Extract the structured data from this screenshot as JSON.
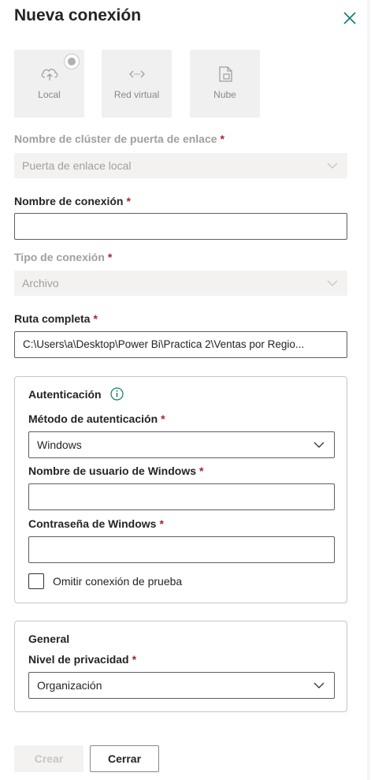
{
  "panel": {
    "title": "Nueva conexión"
  },
  "tiles": [
    {
      "label": "Local",
      "icon": "cloud-upload-icon",
      "selected": true
    },
    {
      "label": "Red virtual",
      "icon": "virtual-network-icon",
      "selected": false
    },
    {
      "label": "Nube",
      "icon": "cloud-file-icon",
      "selected": false
    }
  ],
  "gateway": {
    "label": "Nombre de clúster de puerta de enlace",
    "required": "*",
    "value": "Puerta de enlace local"
  },
  "connection_name": {
    "label": "Nombre de conexión",
    "required": "*",
    "value": ""
  },
  "connection_type": {
    "label": "Tipo de conexión",
    "required": "*",
    "value": "Archivo"
  },
  "full_path": {
    "label": "Ruta completa",
    "required": "*",
    "value": "C:\\Users\\a\\Desktop\\Power Bi\\Practica 2\\Ventas por Regio..."
  },
  "auth": {
    "title": "Autenticación",
    "method_label": "Método de autenticación",
    "method_value": "Windows",
    "username_label": "Nombre de usuario de Windows",
    "username_value": "",
    "password_label": "Contraseña de Windows",
    "password_value": "",
    "skip_test_label": "Omitir conexión de prueba",
    "required": "*"
  },
  "general": {
    "title": "General",
    "privacy_label": "Nivel de privacidad",
    "privacy_value": "Organización",
    "required": "*"
  },
  "footer": {
    "create_label": "Crear",
    "close_label": "Cerrar"
  }
}
